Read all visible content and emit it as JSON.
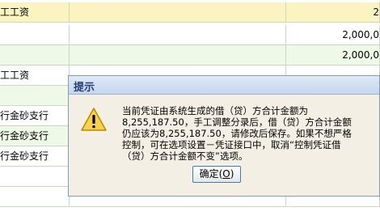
{
  "grid": {
    "rows": [
      {
        "c1": "工工资",
        "c2": "",
        "c3": "2",
        "style": "highlight"
      },
      {
        "c1": "",
        "c2": "",
        "c3": "2,000,0",
        "style": "white"
      },
      {
        "c1": "",
        "c2": "",
        "c3": "2,000,0",
        "style": "green"
      },
      {
        "c1": "工工资",
        "c2": "",
        "c3": "",
        "style": "white"
      },
      {
        "c1": "",
        "c2": "",
        "c3": "",
        "style": "green"
      },
      {
        "c1": "行金砂支行",
        "c2": "",
        "c3": "",
        "style": "white"
      },
      {
        "c1": "行金砂支行",
        "c2": "",
        "c3": "",
        "style": "green"
      },
      {
        "c1": "行金砂支行",
        "c2": "",
        "c3": "",
        "style": "white"
      },
      {
        "c1": "",
        "c2": "",
        "c3": "",
        "style": "white"
      },
      {
        "c1": "",
        "c2": "",
        "c3": "",
        "style": "white"
      }
    ]
  },
  "dialog": {
    "title": "提示",
    "icon": "warning-icon",
    "message_lines": [
      "当前凭证由系统生成的借（贷）方合计金额为",
      "8,255,187.50，手工调整分录后，借（贷）方合计金额",
      "仍应该为8,255,187.50，请修改后保存。如果不想严格",
      "控制，可在选项设置－凭证接口中，取消“控制凭证借",
      "（贷）方合计金额不变”选项。"
    ],
    "ok_label": "确定(",
    "ok_hotkey": "O",
    "ok_suffix": ")"
  }
}
